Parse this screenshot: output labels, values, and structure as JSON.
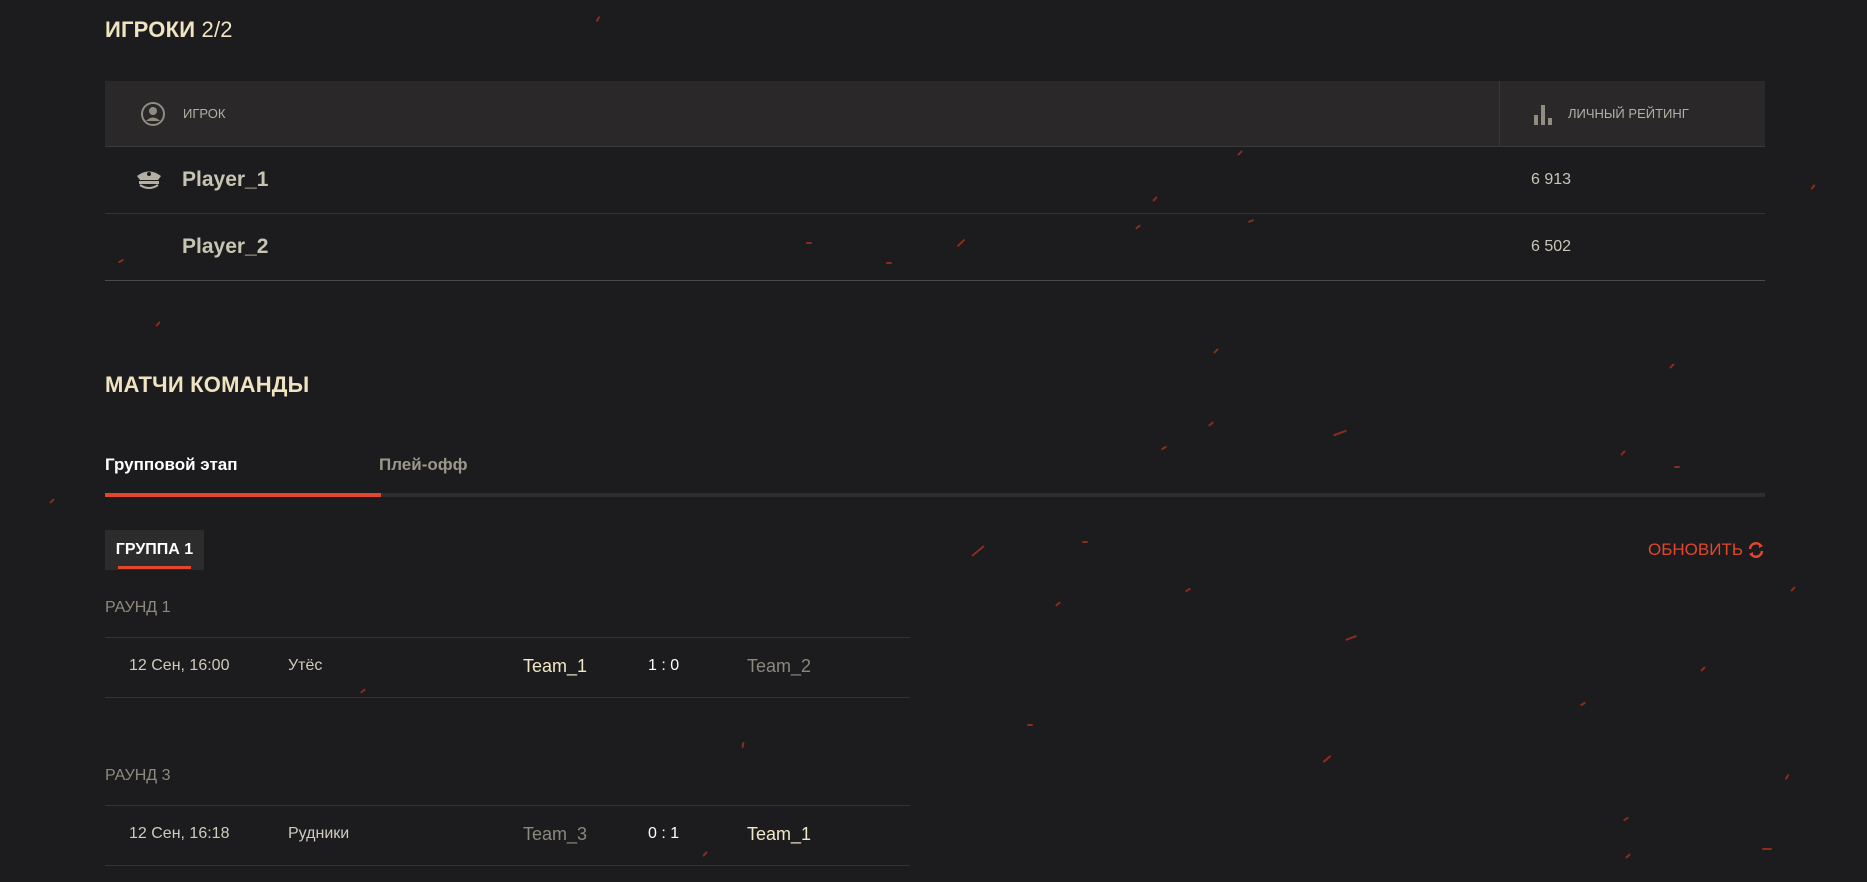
{
  "players_section": {
    "title": "ИГРОКИ",
    "count": "2/2",
    "columns": {
      "player": "ИГРОК",
      "rating": "ЛИЧНЫЙ РЕЙТИНГ"
    },
    "rows": [
      {
        "name": "Player_1",
        "rating": "6 913",
        "role_icon": "commander-cap-icon"
      },
      {
        "name": "Player_2",
        "rating": "6 502",
        "role_icon": ""
      }
    ]
  },
  "matches_section": {
    "title": "МАТЧИ КОМАНДЫ",
    "tabs": [
      {
        "label": "Групповой этап",
        "active": true
      },
      {
        "label": "Плей-офф",
        "active": false
      }
    ],
    "group_button": "ГРУППА 1",
    "refresh_label": "ОБНОВИТЬ",
    "rounds": [
      {
        "label": "РАУНД 1",
        "match": {
          "date": "12 Сен, 16:00",
          "map": "Утёс",
          "team1": "Team_1",
          "score": "1 : 0",
          "team2": "Team_2",
          "winner": "team1"
        }
      },
      {
        "label": "РАУНД 3",
        "match": {
          "date": "12 Сен, 16:18",
          "map": "Рудники",
          "team1": "Team_3",
          "score": "0 : 1",
          "team2": "Team_1",
          "winner": "team2"
        }
      }
    ]
  },
  "colors": {
    "accent": "#e2462c",
    "background": "#1c1c1e",
    "title": "#efe3c1"
  },
  "icons": {
    "player_column": "user-circle-icon",
    "rating_column": "bar-chart-icon",
    "refresh": "refresh-icon"
  }
}
